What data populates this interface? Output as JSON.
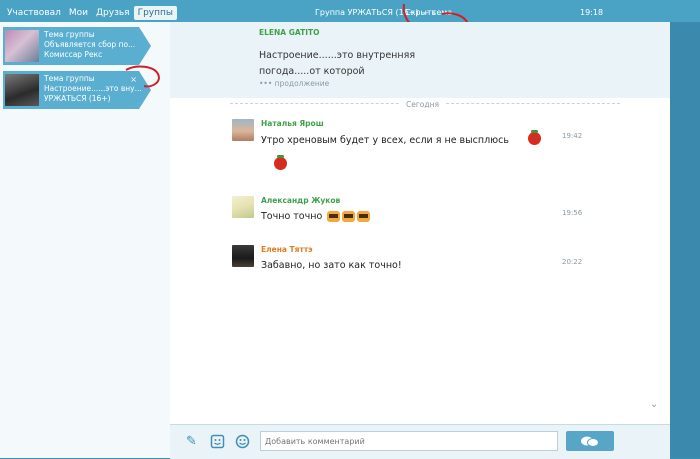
{
  "header": {
    "tabs": [
      {
        "label": "Участвовал",
        "active": false
      },
      {
        "label": "Мои",
        "active": false
      },
      {
        "label": "Друзья",
        "active": false
      },
      {
        "label": "Группы",
        "active": true
      }
    ],
    "title": "Группа УРЖАТЬСЯ (16+) — тема",
    "hide_label": "Скрыть",
    "time": "19:18"
  },
  "sidebar": {
    "conversations": [
      {
        "line1": "Тема группы",
        "line2": "Объявляется сбор по...",
        "line3": "Комиссар Рекс"
      },
      {
        "line1": "Тема группы",
        "line2": "Настроение......это вну...",
        "line3": "УРЖАТЬСЯ (16+)",
        "close": "×"
      }
    ]
  },
  "quote": {
    "author": "ELENA GATITO",
    "text": "Настроение......это внутренняя погода.....от которой",
    "more": "••• продолжение"
  },
  "day_label": "Сегодня",
  "messages": [
    {
      "author": "Наталья Ярош",
      "author_color": "#3fa24a",
      "text": "Утро хреновым будет у всех, если я не высплюсь",
      "time": "19:42"
    },
    {
      "author": "Александр Жуков",
      "author_color": "#3fa24a",
      "text": "Точно точно",
      "time": "19:56"
    },
    {
      "author": "Елена Тяттэ",
      "author_color": "#e07b22",
      "text": "Забавно, но зато как точно!",
      "time": "20:22"
    }
  ],
  "composer": {
    "placeholder": "Добавить комментарий"
  },
  "colors": {
    "frame": "#4aa3c4",
    "accent": "#57a6c8",
    "annotation": "#d0202a"
  }
}
